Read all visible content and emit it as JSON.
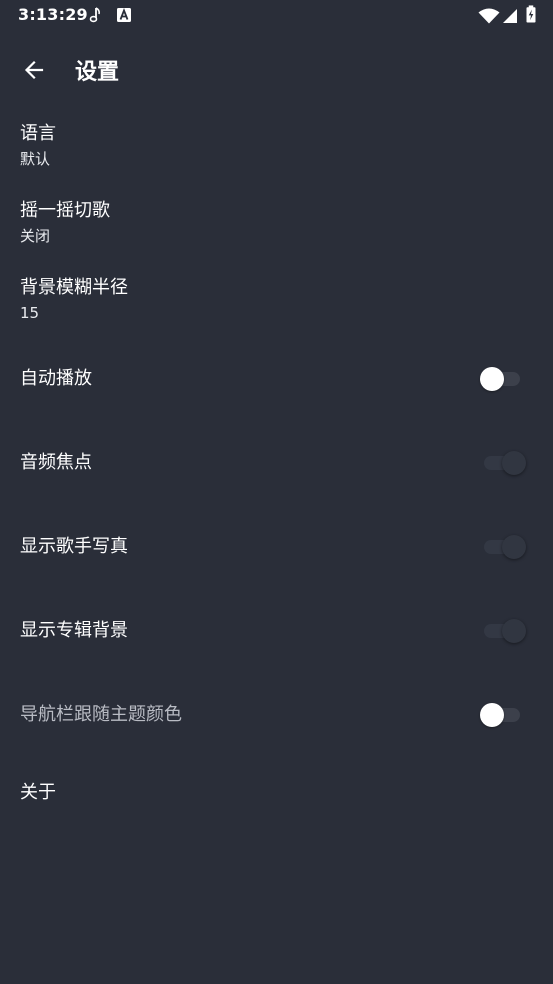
{
  "status_bar": {
    "time": "3:13:29",
    "icons": [
      "music-note-icon",
      "a-box-icon",
      "wifi-icon",
      "signal-icon",
      "battery-charging-icon"
    ]
  },
  "app_bar": {
    "back_icon": "arrow-left-icon",
    "title": "设置"
  },
  "settings": {
    "language": {
      "title": "语言",
      "value": "默认"
    },
    "shake": {
      "title": "摇一摇切歌",
      "value": "关闭"
    },
    "blur": {
      "title": "背景模糊半径",
      "value": "15"
    },
    "autoplay": {
      "title": "自动播放",
      "enabled": true
    },
    "audio_focus": {
      "title": "音频焦点",
      "enabled": false
    },
    "artist_photo": {
      "title": "显示歌手写真",
      "enabled": false
    },
    "album_bg": {
      "title": "显示专辑背景",
      "enabled": false
    },
    "nav_bar_color": {
      "title": "导航栏跟随主题颜色",
      "enabled": true,
      "row_enabled": false
    },
    "about": {
      "title": "关于"
    }
  },
  "colors": {
    "background": "#2a2e39",
    "text": "#ffffff",
    "muted_text": "#b9bcc4"
  }
}
